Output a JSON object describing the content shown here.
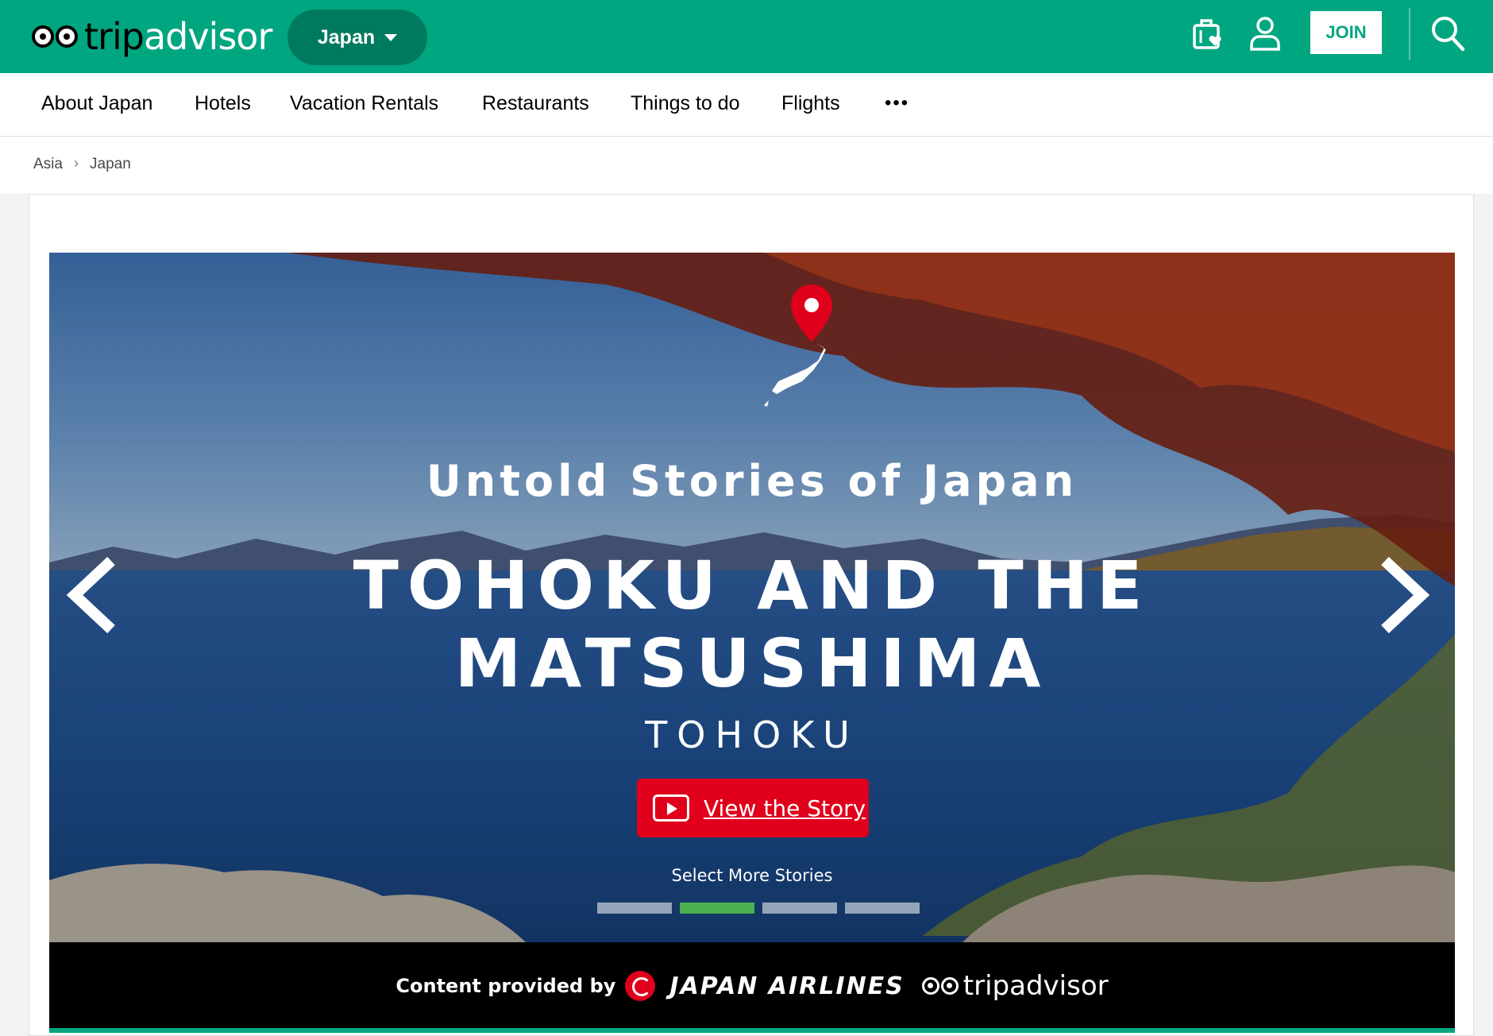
{
  "header": {
    "logo_text_trip": "trip",
    "logo_text_advisor": "advisor",
    "geo_label": "Japan",
    "join_label": "JOIN",
    "icons": [
      "trips-icon",
      "profile-icon",
      "search-icon",
      "chevron-down-icon"
    ],
    "brand_color": "#00a680"
  },
  "nav": {
    "items": [
      "About Japan",
      "Hotels",
      "Vacation Rentals",
      "Restaurants",
      "Things to do",
      "Flights"
    ],
    "more": "•••"
  },
  "breadcrumb": {
    "items": [
      "Asia",
      "Japan"
    ],
    "separator": "›"
  },
  "hero": {
    "kicker": "Untold Stories of Japan",
    "headline_line1": "TOHOKU AND THE",
    "headline_line2": "MATSUSHIMA",
    "region": "TOHOKU",
    "cta_label": "View the Story",
    "more_label": "Select More Stories",
    "story_count": 4,
    "active_story_index": 2,
    "cta_color": "#e0001b",
    "active_dot_color": "#4caf50"
  },
  "credit": {
    "label": "Content provided by",
    "partner_name": "JAPAN AIRLINES",
    "partner2_name": "tripadvisor"
  }
}
